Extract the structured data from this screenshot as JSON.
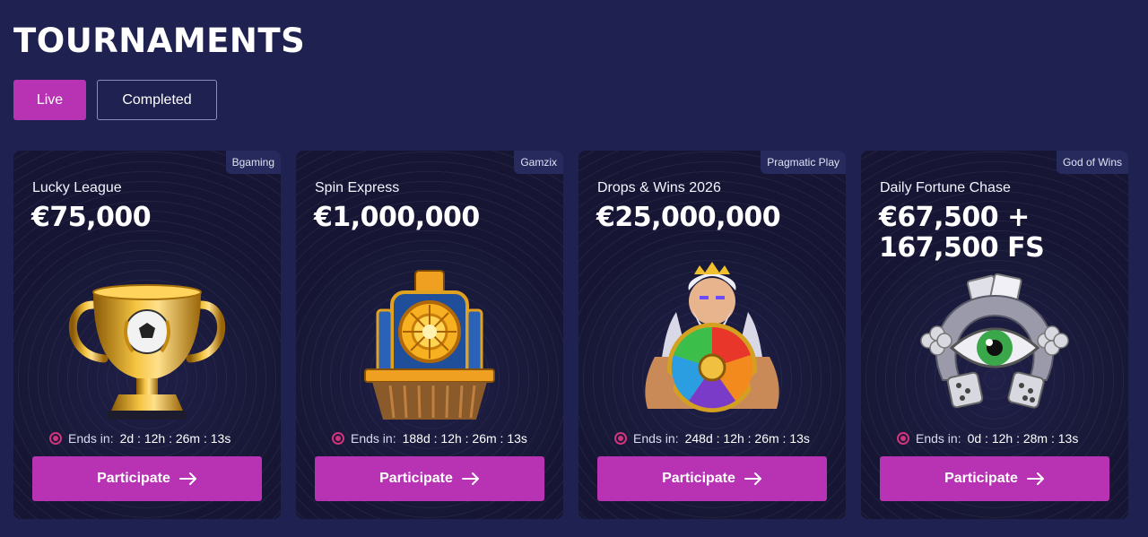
{
  "page": {
    "title": "TOURNAMENTS"
  },
  "tabs": [
    {
      "label": "Live",
      "active": true
    },
    {
      "label": "Completed",
      "active": false
    }
  ],
  "colors": {
    "background": "#1f2250",
    "card": "#161634",
    "accent": "#b832b4",
    "live_dot": "#d0347c"
  },
  "ends_label": "Ends in:",
  "button_label": "Participate",
  "tournaments": [
    {
      "provider": "Bgaming",
      "name": "Lucky League",
      "prize": "€75,000",
      "ends_in": "2d : 12h : 26m : 13s",
      "art": "trophy-icon"
    },
    {
      "provider": "Gamzix",
      "name": "Spin Express",
      "prize": "€1,000,000",
      "ends_in": "188d : 12h : 26m : 13s",
      "art": "train-icon"
    },
    {
      "provider": "Pragmatic Play",
      "name": "Drops & Wins 2026",
      "prize": "€25,000,000",
      "ends_in": "248d : 12h : 26m : 13s",
      "art": "zeus-wheel-icon"
    },
    {
      "provider": "God of Wins",
      "name": "Daily Fortune Chase",
      "prize": "€67,500 + 167,500 FS",
      "ends_in": "0d : 12h : 28m : 13s",
      "art": "eye-horseshoe-icon"
    }
  ]
}
